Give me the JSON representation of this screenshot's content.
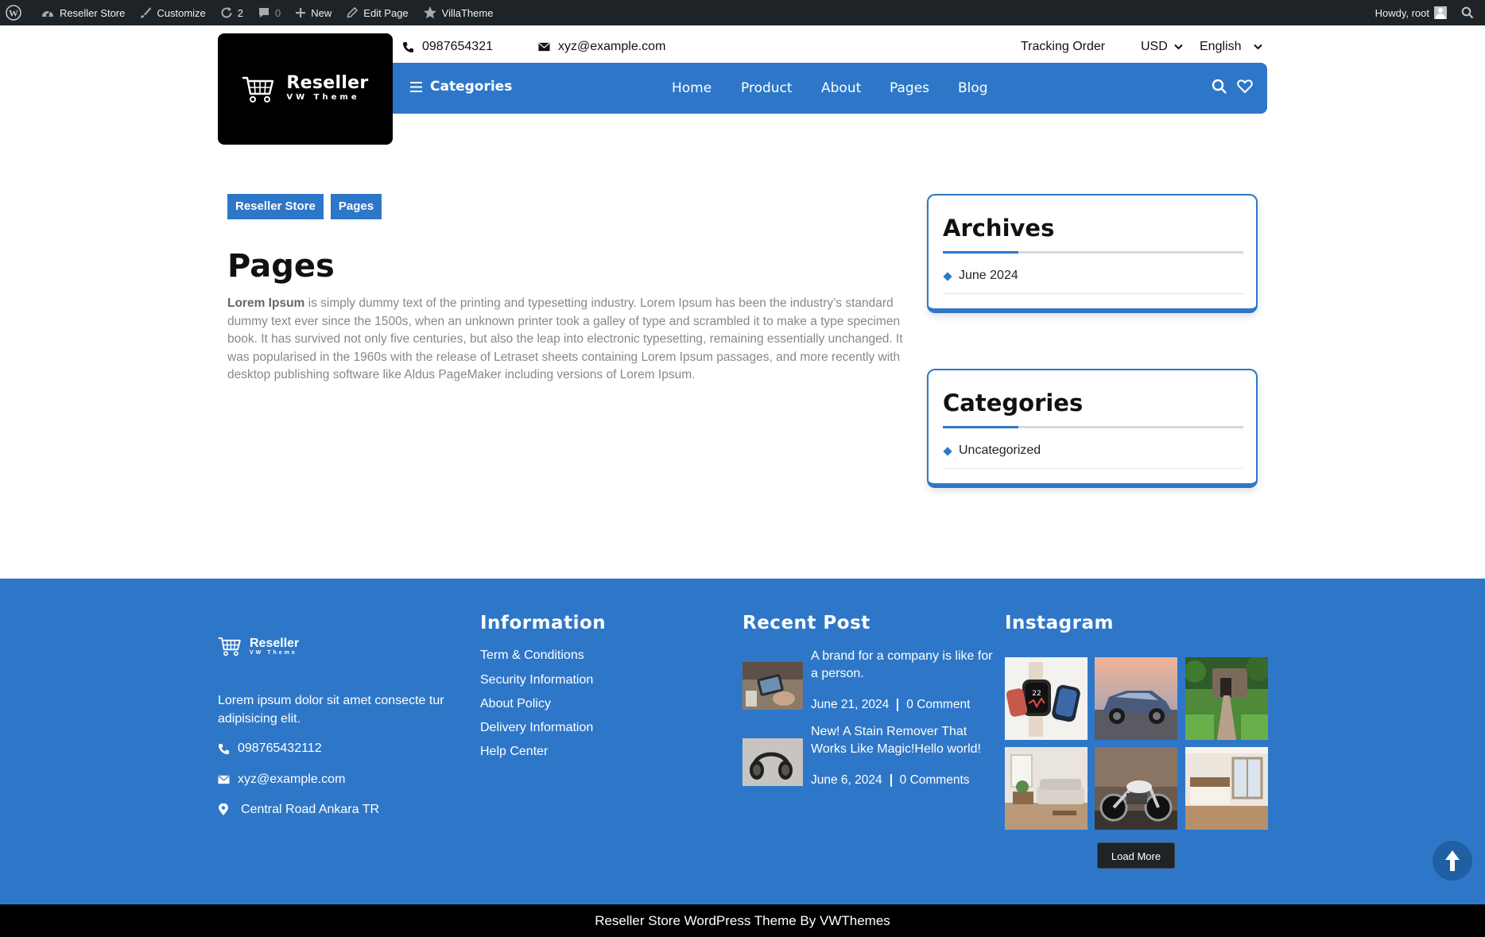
{
  "adminbar": {
    "site_name": "Reseller Store",
    "customize": "Customize",
    "updates_count": "2",
    "comments_count": "0",
    "new": "New",
    "edit_page": "Edit Page",
    "villatheme": "VillaTheme",
    "howdy": "Howdy, root"
  },
  "logo": {
    "title": "Reseller",
    "subtitle": "VW Theme"
  },
  "topbar": {
    "phone": "0987654321",
    "email": "xyz@example.com",
    "tracking": "Tracking Order",
    "currency": "USD",
    "language": "English"
  },
  "nav": {
    "categories": "Categories",
    "links": [
      "Home",
      "Product",
      "About",
      "Pages",
      "Blog"
    ]
  },
  "breadcrumb": [
    "Reseller Store",
    "Pages"
  ],
  "page": {
    "title": "Pages",
    "body_bold": "Lorem Ipsum",
    "body_rest": " is simply dummy text of the printing and typesetting industry. Lorem Ipsum has been the industry’s standard dummy text ever since the 1500s, when an unknown printer took a galley of type and scrambled it to make a type specimen book. It has survived not only five centuries, but also the leap into electronic typesetting, remaining essentially unchanged. It was popularised in the 1960s with the release of Letraset sheets containing Lorem Ipsum passages, and more recently with desktop publishing software like Aldus PageMaker including versions of Lorem Ipsum."
  },
  "sidebar": {
    "archives": {
      "title": "Archives",
      "items": [
        "June 2024"
      ]
    },
    "categories": {
      "title": "Categories",
      "items": [
        "Uncategorized"
      ]
    }
  },
  "footer": {
    "logo": {
      "title": "Reseller",
      "subtitle": "VW Theme"
    },
    "description": "Lorem ipsum dolor sit amet consecte tur adipisicing elit.",
    "phone": "098765432112",
    "email": "xyz@example.com",
    "address": "Central Road Ankara TR",
    "information": {
      "title": "Information",
      "links": [
        "Term & Conditions",
        "Security Information",
        "About Policy",
        "Delivery Information",
        "Help Center"
      ]
    },
    "recent_post": {
      "title": "Recent Post",
      "posts": [
        {
          "title": "A brand for a company is like for a person.",
          "date": "June 21, 2024",
          "comments": "0 Comment"
        },
        {
          "title": "New! A Stain Remover That Works Like Magic!Hello world!",
          "date": "June 6, 2024",
          "comments": "0 Comments"
        }
      ]
    },
    "instagram": {
      "title": "Instagram",
      "load_more": "Load More"
    }
  },
  "copyright": "Reseller Store WordPress Theme By VWThemes",
  "colors": {
    "primary": "#2e77c8",
    "adminbar": "#1d2327",
    "logo_bg": "#000000"
  }
}
